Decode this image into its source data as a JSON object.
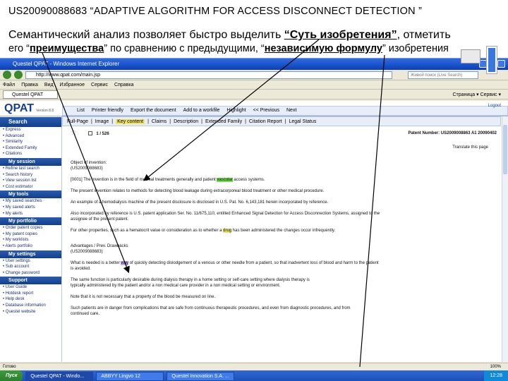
{
  "slide": {
    "title": "US20090088683  “ADAPTIVE ALGORITHM FOR ACCESS DISCONNECT DETECTION ”",
    "line1_prefix": "Семантический анализ позволяет быстро выделить ",
    "line1_highlight": "“Суть изобретения”",
    "line1_suffix": ", отметить",
    "line2_prefix": "его “",
    "line2_highlight1": "преимущества",
    "line2_middle": "” по сравнению с предыдущими, “",
    "line2_highlight2": "независимую формулу",
    "line2_suffix": "” изобретения"
  },
  "browser": {
    "window_title": "Questel QPAT - Windows Internet Explorer",
    "address": "http://www.qpat.com/main.jsp",
    "search_placeholder": "Живой поиск (Live Search)",
    "menu": [
      "Файл",
      "Правка",
      "Вид",
      "Избранное",
      "Сервис",
      "Справка"
    ],
    "tab_title": "Questel QPAT",
    "tab_tools": "Страница ▾  Сервис ▾",
    "status_text": "Готово",
    "zoom": "100%"
  },
  "qpat": {
    "logo": "QPAT",
    "logo_version": "Version 8.8",
    "login": "Logout",
    "toolbar1": [
      "List",
      "Printer friendly",
      "Export the document",
      "Add to a workfile",
      "Highlight",
      "<< Previous",
      "Next"
    ],
    "toolbar2": [
      {
        "label": "Full-Page",
        "hi": false
      },
      {
        "label": "Image",
        "hi": false
      },
      {
        "label": "Key content",
        "hi": true
      },
      {
        "label": "Claims",
        "hi": false
      },
      {
        "label": "Description",
        "hi": false
      },
      {
        "label": "Extended Family",
        "hi": false
      },
      {
        "label": "Citation Report",
        "hi": false
      },
      {
        "label": "Legal Status",
        "hi": false
      }
    ]
  },
  "sidebar": {
    "sections": [
      {
        "title": "Search",
        "items": [
          "Express",
          "Advanced",
          "Similarity",
          "Extended Family",
          "Citations"
        ]
      },
      {
        "title": "My session",
        "items": [
          "Refine last search",
          "Search history",
          "View session list",
          "Cost estimator"
        ]
      },
      {
        "title": "My tools",
        "items": [
          "My saved searches",
          "My saved alerts",
          "My alerts"
        ]
      },
      {
        "title": "My portfolio",
        "items": [
          "Order patent copies",
          "My patent copies",
          "My worklists",
          "Alerts portfolio"
        ]
      },
      {
        "title": "My settings",
        "items": [
          "User settings",
          "Sub account",
          "Change password"
        ]
      },
      {
        "title": "Support",
        "items": [
          "User Guide",
          "Hotdesk report",
          "Help desk",
          "Database information",
          "Questel website"
        ]
      }
    ]
  },
  "document": {
    "record": "1 / 526",
    "patent_number": "Patent Number: US2009008863 A1 20090402",
    "translate": "Translate this page",
    "object_heading": "Object of invention:",
    "object_number": "(US2009088683)",
    "object_text_a": "[0001] The invention is in the field of medical treatments generally and patient ",
    "object_highlight": "vascular",
    "object_text_b": " access systems.",
    "p2": "The present invention relates to methods for detecting blood leakage during extracorporeal blood treatment or other medical procedure.",
    "p3": "An example of a hemodialysis machine of the present disclosure is disclosed in U.S. Pat. No. 6,143,181 herein incorporated by reference.",
    "p4a": "Also incorporated by reference is U.S. patent application Ser. No. 11/675,110, entitled Enhanced Signal Detection for Access Disconnection Systems, assigned to the",
    "p4b": "assignee of the present patent.",
    "p5a": "For other properties, such as a hematocrit value or consideration as to whether a ",
    "p5_highlight": "drug",
    "p5b": " has been administered the changes occur infrequently.",
    "adv_heading": "Advantages / Prev. Drawbacks",
    "adv_number": "(US2009088683)",
    "p6a": "What is needed is a better ",
    "p6_highlight": "way",
    "p6b": " of quickly detecting dislodgement of a venous or other needle from a patient, so that inadvertent loss of blood and harm to the patient",
    "p6c": "is avoided.",
    "p7a": "The same function is particularly desirable during dialysis therapy in a home setting or self-care setting where dialysis therapy is",
    "p7b": "typically administered by the patient and/or a non medical care provider in a non medical setting or environment.",
    "p8": "Note that it is not necessary that a property of the blood be measured on line.",
    "p9a": "Such patients are in danger from complications that are safe from continuous therapeutic procedures, and even from diagnostic procedures, and from",
    "p9b": "continued care."
  },
  "taskbar": {
    "start": "Пуск",
    "tasks": [
      "Questel QPAT - Windo...",
      "ABBYY Lingvo 12",
      "Questel Innovation S.A. ..."
    ],
    "clock": "12:28"
  }
}
